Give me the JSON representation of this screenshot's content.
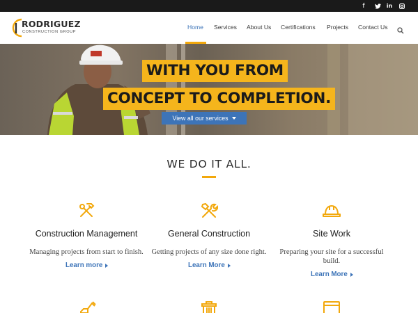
{
  "social": {
    "items": [
      {
        "name": "facebook-icon",
        "glyph": "f"
      },
      {
        "name": "twitter-icon",
        "glyph": "🐦"
      },
      {
        "name": "linkedin-icon",
        "glyph": "in"
      },
      {
        "name": "instagram-icon",
        "glyph": "◙"
      }
    ]
  },
  "logo": {
    "name": "RODRIGUEZ",
    "tagline": "CONSTRUCTION GROUP"
  },
  "nav": {
    "home": "Home",
    "services": "Services",
    "about": "About Us",
    "certifications": "Certifications",
    "projects": "Projects",
    "contact": "Contact Us"
  },
  "hero": {
    "line1": "WITH YOU FROM",
    "line2": "CONCEPT TO COMPLETION.",
    "cta": "View all our services"
  },
  "section": {
    "title": "WE DO IT ALL."
  },
  "services": [
    {
      "icon": "hammer-wrench-icon",
      "title": "Construction Management",
      "desc": [
        "Managing projects from start to finish."
      ],
      "link": "Learn more"
    },
    {
      "icon": "crossed-tools-icon",
      "title": "General Construction",
      "desc": [
        "Getting projects of any size done right."
      ],
      "link": "Learn More"
    },
    {
      "icon": "hard-hat-icon",
      "title": "Site Work",
      "desc": [
        "Preparing your site for a successful",
        "build."
      ],
      "link": "Learn More"
    }
  ],
  "bottom_icons": [
    "excavator-icon",
    "toolbox-icon",
    "window-icon"
  ],
  "colors": {
    "accent": "#f2a80c",
    "highlight": "#f5b51c",
    "link": "#3d74b8",
    "topbar": "#1a1a1a"
  }
}
